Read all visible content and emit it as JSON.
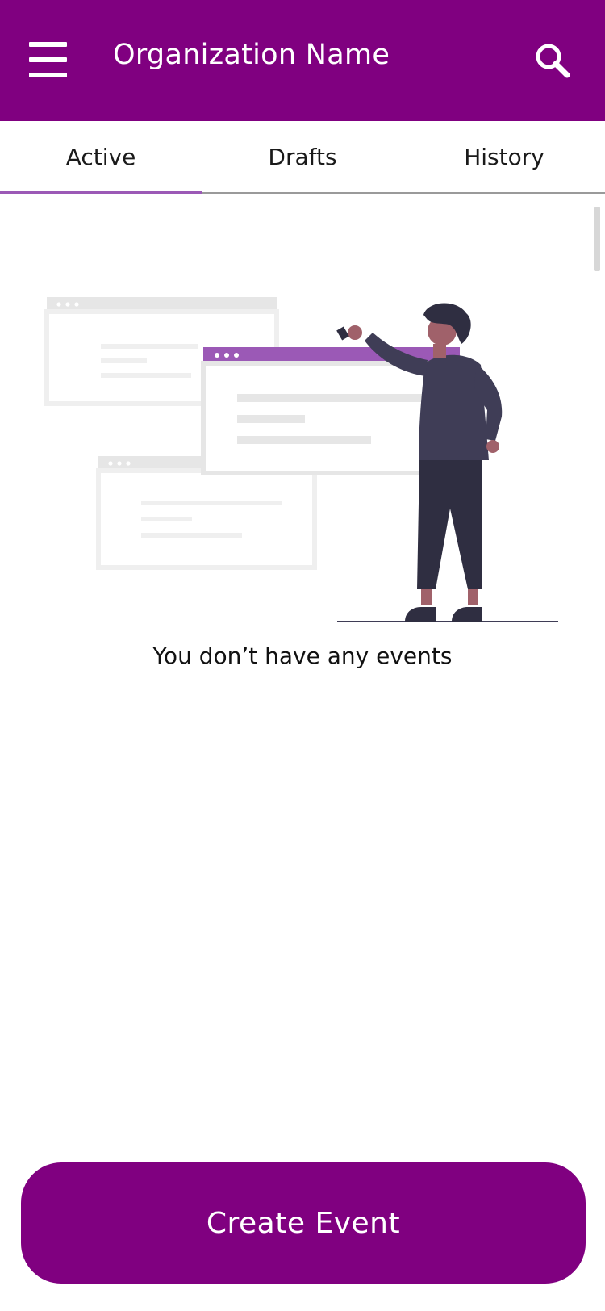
{
  "header": {
    "title": "Organization Name",
    "menu_icon": "menu-icon",
    "search_icon": "search-icon",
    "background": "#800080"
  },
  "tabs": [
    {
      "label": "Active",
      "selected": true
    },
    {
      "label": "Drafts",
      "selected": false
    },
    {
      "label": "History",
      "selected": false
    }
  ],
  "empty_state": {
    "illustration": "person-pointing-at-browser-windows-illustration",
    "message": "You don’t have any events"
  },
  "actions": {
    "create_label": "Create Event"
  },
  "colors": {
    "primary": "#800080",
    "accent": "#9b59b6"
  }
}
